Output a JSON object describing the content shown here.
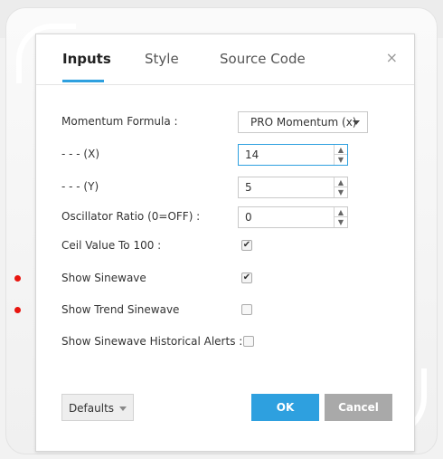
{
  "tabs": [
    {
      "label": "Inputs",
      "active": true
    },
    {
      "label": "Style",
      "active": false
    },
    {
      "label": "Source Code",
      "active": false
    }
  ],
  "close_icon": "×",
  "fields": {
    "momentum_formula": {
      "label": "Momentum Formula :",
      "value": "PRO Momentum (x)"
    },
    "x": {
      "label": "- - - (X)",
      "value": "14"
    },
    "y": {
      "label": "- - - (Y)",
      "value": "5"
    },
    "oscillator_ratio": {
      "label": "Oscillator Ratio (0=OFF) :",
      "value": "0"
    },
    "ceil_value": {
      "label": "Ceil Value To 100 :",
      "checked": true
    },
    "show_sinewave": {
      "label": "Show Sinewave",
      "checked": true
    },
    "show_trend_sinewave": {
      "label": "Show Trend Sinewave",
      "checked": false
    },
    "show_sinewave_alerts": {
      "label": "Show Sinewave Historical Alerts :",
      "checked": false
    }
  },
  "checkmark": "✔",
  "buttons": {
    "defaults": "Defaults",
    "ok": "OK",
    "cancel": "Cancel"
  },
  "colors": {
    "accent": "#2ea0df",
    "marker": "#e8150f",
    "cancel": "#a9a9a9"
  }
}
